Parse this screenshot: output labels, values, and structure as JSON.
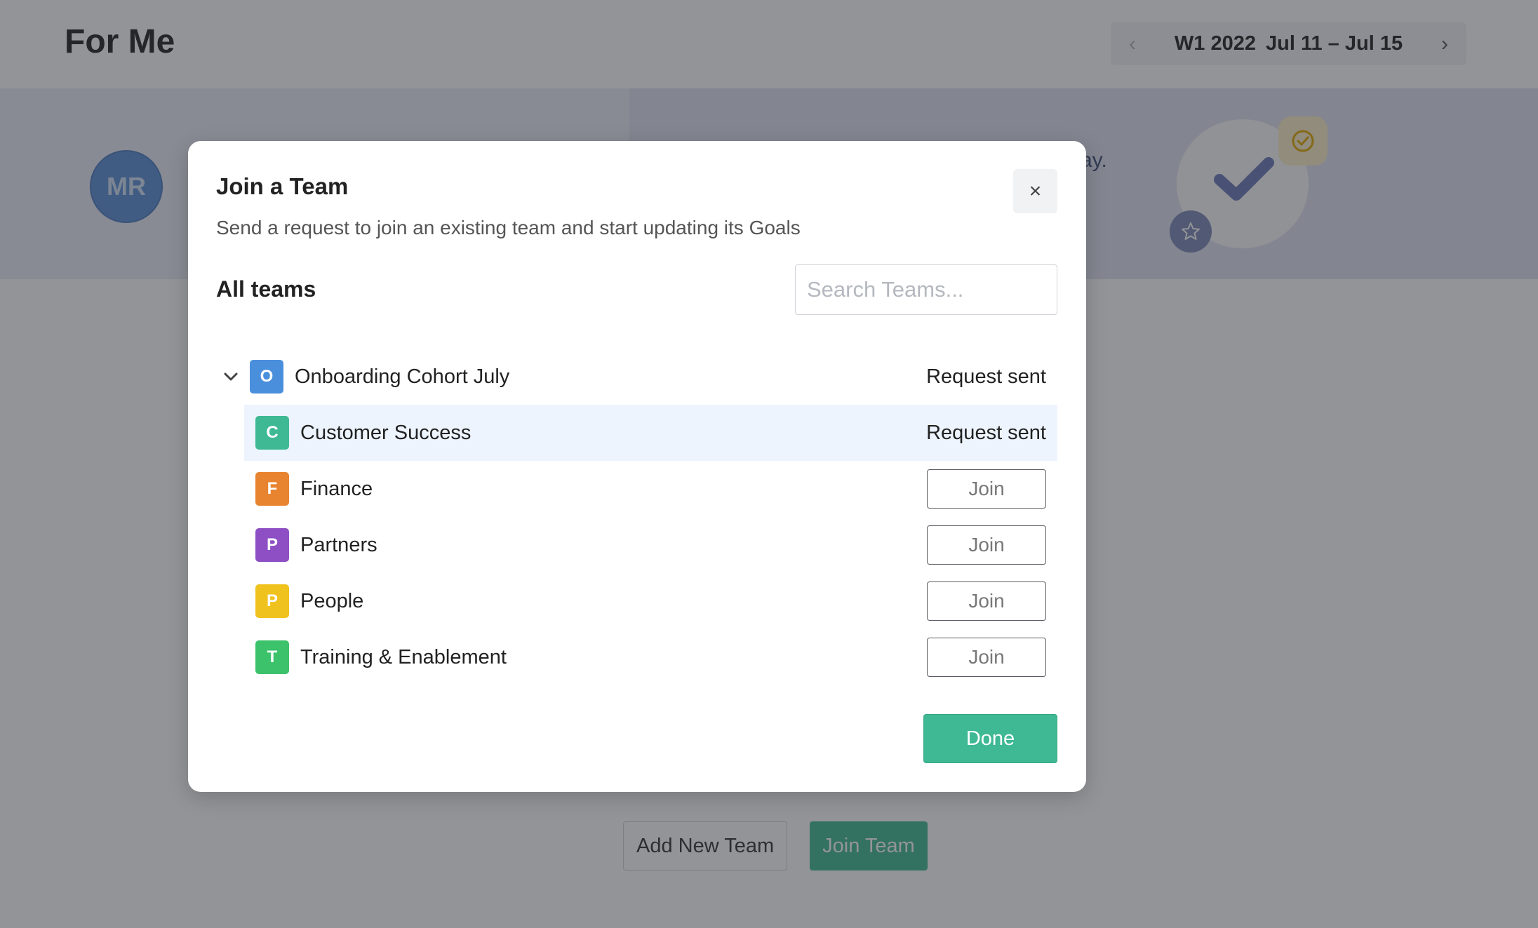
{
  "page": {
    "title": "For Me",
    "week_nav": {
      "prev_label": "‹",
      "next_label": "›",
      "week": "W1 2022",
      "range": "Jul 11 – Jul 15"
    },
    "avatar_initials": "MR",
    "banner_text_fragment": "ay.",
    "bottom_actions": {
      "add_new_team": "Add New Team",
      "join_team": "Join Team"
    }
  },
  "modal": {
    "title": "Join a Team",
    "subtitle": "Send a request to join an existing team and start updating its Goals",
    "close_label": "×",
    "section_title": "All teams",
    "search_placeholder": "Search Teams...",
    "parent_team": {
      "letter": "O",
      "name": "Onboarding Cohort July",
      "status": "Request sent",
      "color": "#4a8fdc"
    },
    "teams": [
      {
        "letter": "C",
        "name": "Customer Success",
        "status": "Request sent",
        "color": "#3fb993"
      },
      {
        "letter": "F",
        "name": "Finance",
        "action": "Join",
        "color": "#e8832f"
      },
      {
        "letter": "P",
        "name": "Partners",
        "action": "Join",
        "color": "#8e4fc4"
      },
      {
        "letter": "P",
        "name": "People",
        "action": "Join",
        "color": "#f0c21e"
      },
      {
        "letter": "T",
        "name": "Training & Enablement",
        "action": "Join",
        "color": "#3cc26a"
      }
    ],
    "done_label": "Done"
  },
  "colors": {
    "accent_green": "#3fb993",
    "highlight_row": "#edf4fe"
  }
}
